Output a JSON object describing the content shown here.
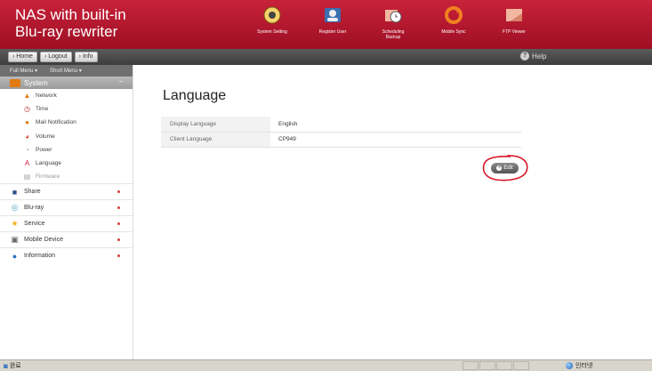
{
  "header": {
    "brand_line1": "NAS with built-in",
    "brand_line2": "Blu-ray rewriter",
    "nav": [
      {
        "label": "System Setting",
        "icon": "gear-icon"
      },
      {
        "label": "Register User",
        "icon": "user-icon"
      },
      {
        "label": "Scheduling\nBackup",
        "icon": "clock-folder-icon"
      },
      {
        "label": "Mobile Sync",
        "icon": "sync-icon"
      },
      {
        "label": "FTP Viewer",
        "icon": "folder-icon"
      }
    ]
  },
  "toolbar": {
    "home": "Home",
    "logout": "Logout",
    "info": "Info",
    "help": "Help"
  },
  "sidebar": {
    "tabs": [
      "Full Menu ▾",
      "Short Menu ▾"
    ],
    "system_label": "System",
    "system_items": [
      {
        "label": "Network",
        "icon": "network-icon"
      },
      {
        "label": "Time",
        "icon": "clock-icon"
      },
      {
        "label": "Mail Notification",
        "icon": "mail-icon"
      },
      {
        "label": "Volume",
        "icon": "volume-icon"
      },
      {
        "label": "Power",
        "icon": "power-icon"
      },
      {
        "label": "Language",
        "icon": "language-icon"
      },
      {
        "label": "Firmware",
        "icon": "firmware-icon"
      }
    ],
    "main_items": [
      {
        "label": "Share",
        "icon": "share-icon"
      },
      {
        "label": "Blu-ray",
        "icon": "disc-icon"
      },
      {
        "label": "Service",
        "icon": "star-icon"
      },
      {
        "label": "Mobile Device",
        "icon": "mobile-icon"
      },
      {
        "label": "Information",
        "icon": "info-icon"
      }
    ]
  },
  "main": {
    "title": "Language",
    "rows": [
      {
        "label": "Display Language",
        "value": "English"
      },
      {
        "label": "Client Language",
        "value": "CP949"
      }
    ],
    "edit_label": "Edit"
  },
  "statusbar": {
    "left": "완료",
    "right": "인터넷"
  },
  "colors": {
    "header_red": "#b81a30",
    "toolbar_dark": "#4a4a4a",
    "system_orange": "#e07a10",
    "annotation_red": "#d8192a"
  }
}
